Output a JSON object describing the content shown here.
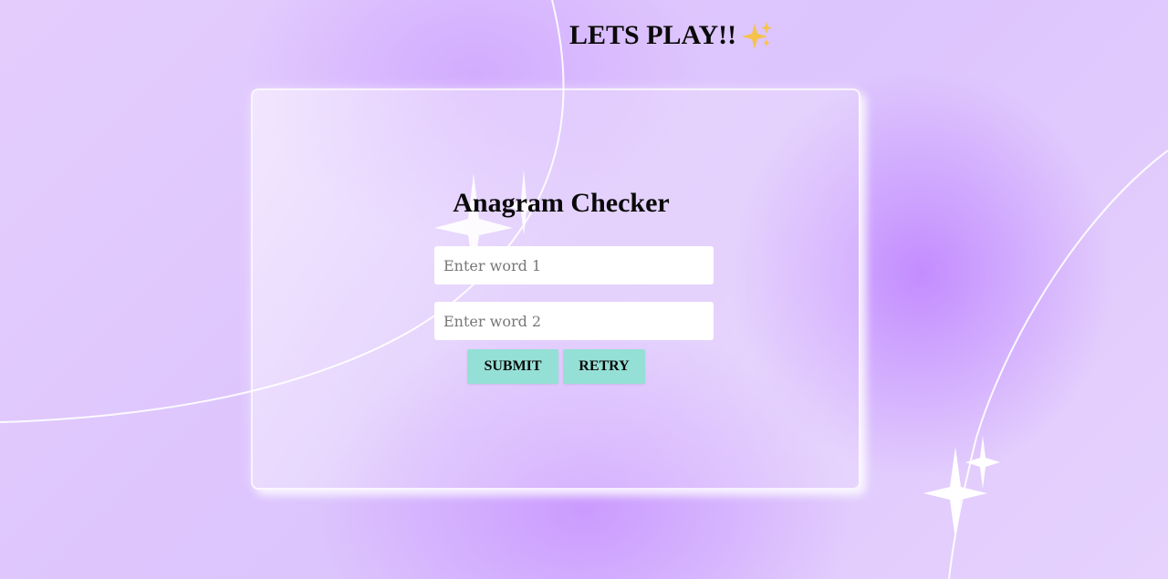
{
  "page": {
    "heading": "LETS PLAY!!",
    "heading_icon": "sparkles-icon"
  },
  "card": {
    "title": "Anagram Checker",
    "inputs": [
      {
        "placeholder": "Enter word 1",
        "value": ""
      },
      {
        "placeholder": "Enter word 2",
        "value": ""
      }
    ],
    "buttons": {
      "submit_label": "SUBMIT",
      "retry_label": "RETRY"
    }
  },
  "colors": {
    "background": "#dcc4fd",
    "button": "#95e0d6",
    "sparkle": "#ffffff",
    "emoji": "#f5c24a"
  }
}
